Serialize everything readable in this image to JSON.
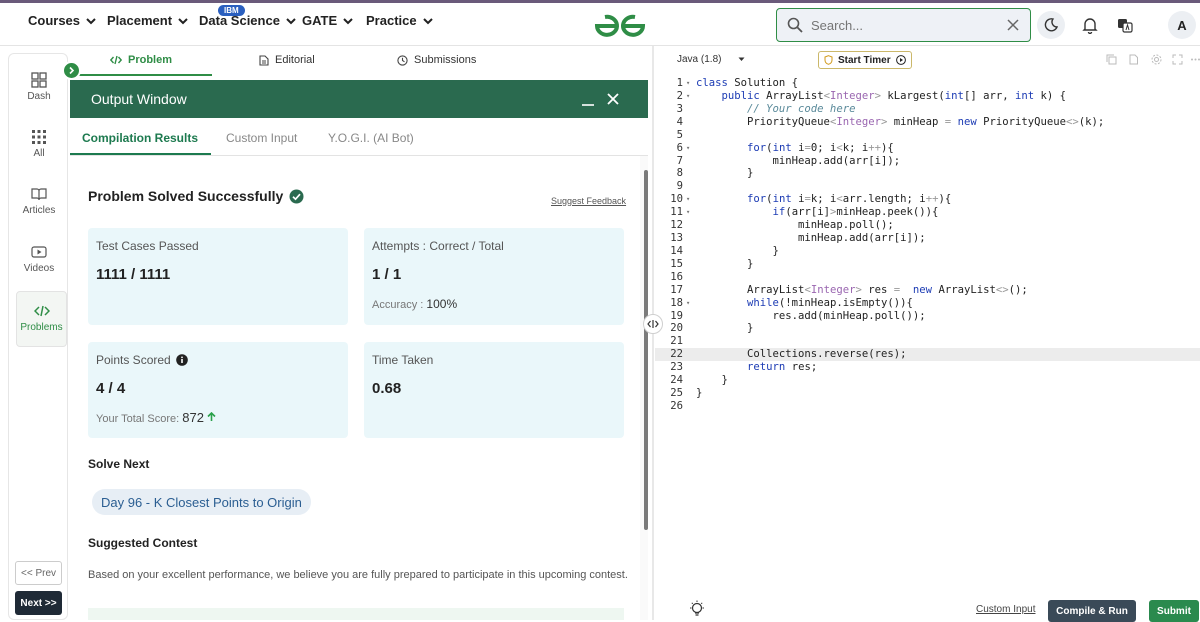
{
  "nav": {
    "items": [
      "Courses",
      "Placement",
      "Data Science",
      "GATE",
      "Practice"
    ],
    "ibm_badge": "IBM",
    "search_placeholder": "Search...",
    "avatar_initial": "A"
  },
  "leftbar": {
    "items": [
      "Dash",
      "All",
      "Articles",
      "Videos",
      "Problems"
    ],
    "prev": "<< Prev",
    "next": "Next >>"
  },
  "problem_tabs": [
    "Problem",
    "Editorial",
    "Submissions"
  ],
  "output": {
    "title": "Output Window",
    "tabs": [
      "Compilation Results",
      "Custom Input",
      "Y.O.G.I. (AI Bot)"
    ],
    "status": "Problem Solved Successfully",
    "feedback": "Suggest Feedback",
    "test_cases_label": "Test Cases Passed",
    "test_cases_value": "1111 / 1111",
    "attempts_label": "Attempts : Correct / Total",
    "attempts_value": "1 / 1",
    "accuracy_label": "Accuracy :",
    "accuracy_value": "100%",
    "points_label": "Points Scored",
    "points_value": "4 / 4",
    "total_score_label": "Your Total Score:",
    "total_score_value": "872",
    "time_label": "Time Taken",
    "time_value": "0.68",
    "solve_next_heading": "Solve Next",
    "solve_next_chip": "Day 96 - K Closest Points to Origin",
    "contest_heading": "Suggested Contest",
    "contest_text": "Based on your excellent performance, we believe you are fully prepared to participate in this upcoming contest."
  },
  "editor": {
    "language": "Java (1.8)",
    "timer_label": "Start Timer",
    "custom_input_link": "Custom Input",
    "compile_button": "Compile & Run",
    "submit_button": "Submit",
    "code_lines": [
      "class Solution {",
      "    public ArrayList<Integer> kLargest(int[] arr, int k) {",
      "        // Your code here",
      "        PriorityQueue<Integer> minHeap = new PriorityQueue<>(k);",
      "",
      "        for(int i=0; i<k; i++){",
      "            minHeap.add(arr[i]);",
      "        }",
      "",
      "        for(int i=k; i<arr.length; i++){",
      "            if(arr[i]>minHeap.peek()){",
      "                minHeap.poll();",
      "                minHeap.add(arr[i]);",
      "            }",
      "        }",
      "",
      "        ArrayList<Integer> res =  new ArrayList<>();",
      "        while(!minHeap.isEmpty()){",
      "            res.add(minHeap.poll());",
      "        }",
      "",
      "        Collections.reverse(res);",
      "        return res;",
      "    }",
      "}",
      ""
    ],
    "fold_lines": [
      1,
      2,
      6,
      10,
      11,
      18
    ],
    "highlight_line": 22
  },
  "colors": {
    "brand_green": "#2f8d46",
    "output_header": "#2a6a4f",
    "card_bg": "#eaf7fa",
    "compile_bg": "#3a4a58",
    "submit_bg": "#2a8a4e"
  }
}
